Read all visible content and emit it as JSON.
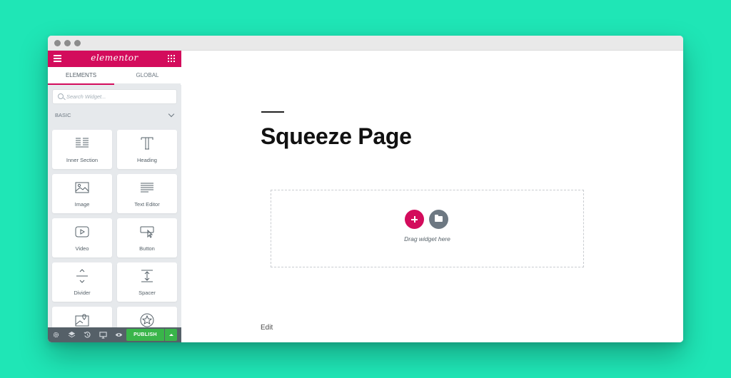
{
  "sidebar": {
    "logo": "elementor",
    "tabs": [
      {
        "label": "ELEMENTS"
      },
      {
        "label": "GLOBAL"
      }
    ],
    "search": {
      "placeholder": "Search Widget..."
    },
    "section_title": "BASIC",
    "widgets": [
      {
        "label": "Inner Section",
        "icon": "inner-section-icon"
      },
      {
        "label": "Heading",
        "icon": "heading-icon"
      },
      {
        "label": "Image",
        "icon": "image-icon"
      },
      {
        "label": "Text Editor",
        "icon": "text-editor-icon"
      },
      {
        "label": "Video",
        "icon": "video-icon"
      },
      {
        "label": "Button",
        "icon": "button-icon"
      },
      {
        "label": "Divider",
        "icon": "divider-icon"
      },
      {
        "label": "Spacer",
        "icon": "spacer-icon"
      },
      {
        "label": "",
        "icon": "google-maps-icon"
      },
      {
        "label": "",
        "icon": "star-icon"
      }
    ],
    "footer": {
      "publish_label": "PUBLISH"
    }
  },
  "canvas": {
    "title": "Squeeze Page",
    "drop_text": "Drag widget here",
    "edit_label": "Edit"
  },
  "colors": {
    "brand": "#d30c5c",
    "publish": "#39b54a",
    "background": "#1fe6b6",
    "panel": "#e6e9ec"
  }
}
